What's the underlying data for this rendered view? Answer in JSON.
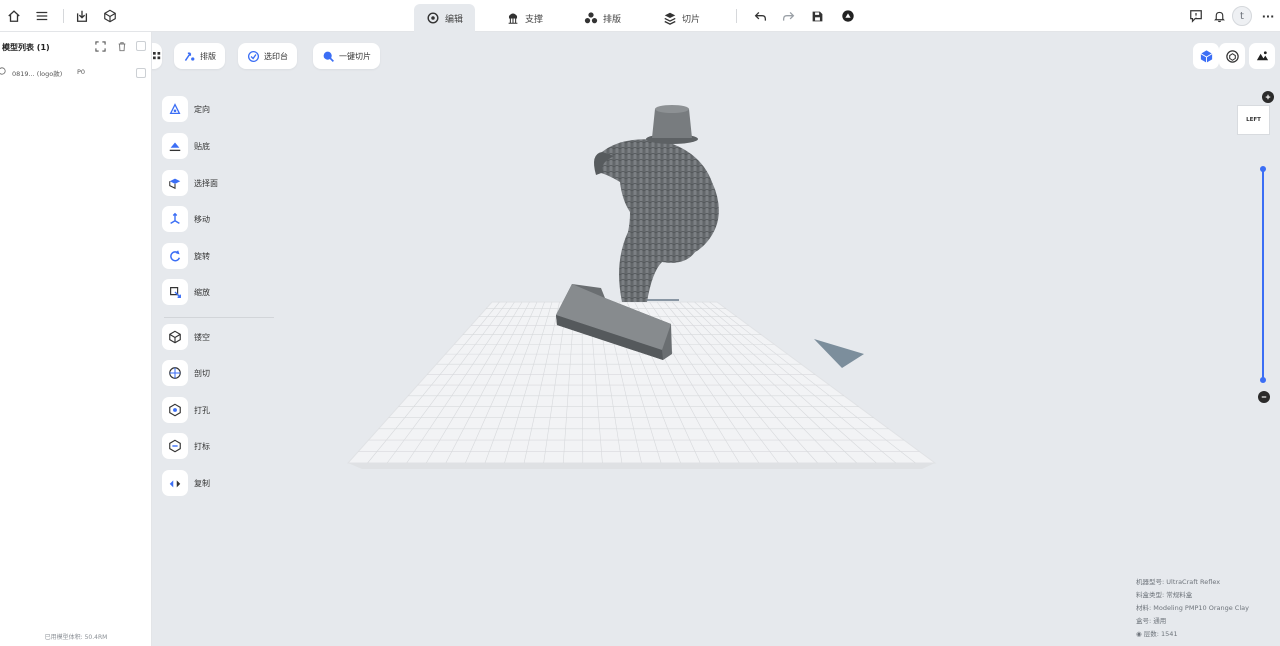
{
  "topbar": {
    "icons": [
      "home-icon",
      "list-icon",
      "import-icon",
      "cube-icon"
    ],
    "modes": [
      {
        "label": "编辑",
        "icon": "edit-mode-icon",
        "active": true
      },
      {
        "label": "支撑",
        "icon": "support-icon",
        "active": false
      },
      {
        "label": "排版",
        "icon": "layout-icon",
        "active": false
      },
      {
        "label": "切片",
        "icon": "slice-icon",
        "active": false
      }
    ],
    "actions": [
      "undo-icon",
      "redo-icon",
      "save-icon",
      "print-icon"
    ],
    "right_icons": [
      "feedback-icon",
      "bell-icon",
      "avatar",
      "more-icon"
    ],
    "avatar_initial": "t",
    "more_label": "···"
  },
  "left_panel": {
    "title": "模型列表 (1)",
    "item": {
      "name": "0819... (logo款)",
      "tag": "P0"
    },
    "footer": "已用模型体积: 50.4RM"
  },
  "toolbar": {
    "buttons": [
      {
        "label": "排版",
        "icon": "arrange-icon"
      },
      {
        "label": "选印台",
        "icon": "select-plate-icon"
      },
      {
        "label": "一键切片",
        "icon": "one-click-slice-icon"
      }
    ]
  },
  "tools": [
    {
      "label": "定向",
      "icon": "orient-icon"
    },
    {
      "label": "贴底",
      "icon": "lay-flat-icon"
    },
    {
      "label": "选择面",
      "icon": "select-face-icon"
    },
    {
      "label": "移动",
      "icon": "move-icon"
    },
    {
      "label": "旋转",
      "icon": "rotate-icon"
    },
    {
      "label": "缩放",
      "icon": "scale-icon"
    },
    {
      "label": "镂空",
      "icon": "hollow-icon"
    },
    {
      "label": "剖切",
      "icon": "cut-icon"
    },
    {
      "label": "打孔",
      "icon": "punch-hole-icon"
    },
    {
      "label": "打标",
      "icon": "label-icon"
    },
    {
      "label": "复制",
      "icon": "copy-icon"
    }
  ],
  "view": {
    "cube_label": "LEFT",
    "buttons": [
      "perspective-cube-icon",
      "model-view-icon",
      "camera-view-icon"
    ]
  },
  "info": {
    "rows": [
      {
        "label": "机器型号:",
        "value": "UltraCraft Reflex"
      },
      {
        "label": "料盒类型:",
        "value": "常规料盒"
      },
      {
        "label": "材料:",
        "value": "Modeling PMP10 Orange Clay"
      },
      {
        "label": "盒号:",
        "value": "通用"
      },
      {
        "label": "层数:",
        "value": "1541"
      }
    ]
  },
  "colors": {
    "accent": "#3b6ef5",
    "viewport_bg": "#e6e9ed",
    "model": "#6f7376",
    "plate": "#f2f3f5"
  }
}
